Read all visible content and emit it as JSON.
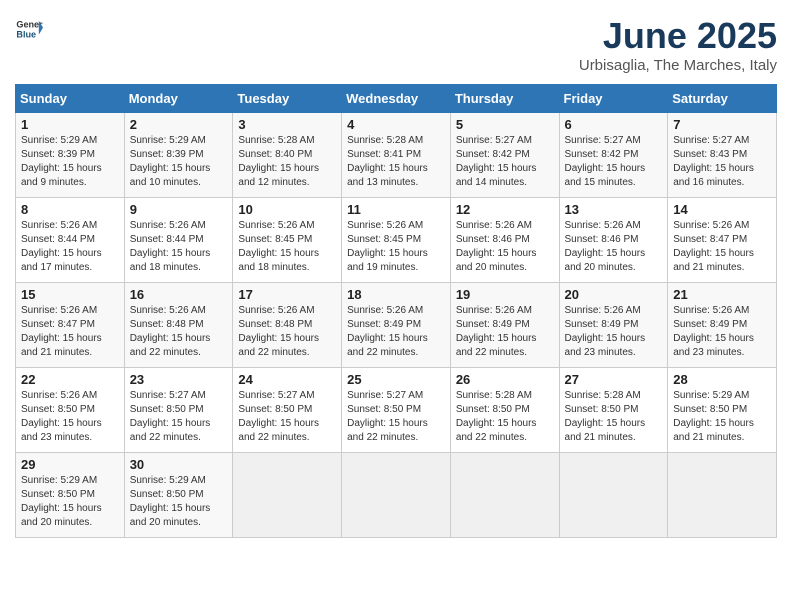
{
  "header": {
    "logo_general": "General",
    "logo_blue": "Blue",
    "title": "June 2025",
    "subtitle": "Urbisaglia, The Marches, Italy"
  },
  "calendar": {
    "days_of_week": [
      "Sunday",
      "Monday",
      "Tuesday",
      "Wednesday",
      "Thursday",
      "Friday",
      "Saturday"
    ],
    "weeks": [
      [
        {
          "day": "",
          "info": ""
        },
        {
          "day": "2",
          "info": "Sunrise: 5:29 AM\nSunset: 8:39 PM\nDaylight: 15 hours and 10 minutes."
        },
        {
          "day": "3",
          "info": "Sunrise: 5:28 AM\nSunset: 8:40 PM\nDaylight: 15 hours and 12 minutes."
        },
        {
          "day": "4",
          "info": "Sunrise: 5:28 AM\nSunset: 8:41 PM\nDaylight: 15 hours and 13 minutes."
        },
        {
          "day": "5",
          "info": "Sunrise: 5:27 AM\nSunset: 8:42 PM\nDaylight: 15 hours and 14 minutes."
        },
        {
          "day": "6",
          "info": "Sunrise: 5:27 AM\nSunset: 8:42 PM\nDaylight: 15 hours and 15 minutes."
        },
        {
          "day": "7",
          "info": "Sunrise: 5:27 AM\nSunset: 8:43 PM\nDaylight: 15 hours and 16 minutes."
        }
      ],
      [
        {
          "day": "1",
          "info": "Sunrise: 5:29 AM\nSunset: 8:39 PM\nDaylight: 15 hours and 9 minutes."
        },
        {
          "day": "",
          "info": ""
        },
        {
          "day": "",
          "info": ""
        },
        {
          "day": "",
          "info": ""
        },
        {
          "day": "",
          "info": ""
        },
        {
          "day": "",
          "info": ""
        },
        {
          "day": "",
          "info": ""
        }
      ],
      [
        {
          "day": "8",
          "info": "Sunrise: 5:26 AM\nSunset: 8:44 PM\nDaylight: 15 hours and 17 minutes."
        },
        {
          "day": "9",
          "info": "Sunrise: 5:26 AM\nSunset: 8:44 PM\nDaylight: 15 hours and 18 minutes."
        },
        {
          "day": "10",
          "info": "Sunrise: 5:26 AM\nSunset: 8:45 PM\nDaylight: 15 hours and 18 minutes."
        },
        {
          "day": "11",
          "info": "Sunrise: 5:26 AM\nSunset: 8:45 PM\nDaylight: 15 hours and 19 minutes."
        },
        {
          "day": "12",
          "info": "Sunrise: 5:26 AM\nSunset: 8:46 PM\nDaylight: 15 hours and 20 minutes."
        },
        {
          "day": "13",
          "info": "Sunrise: 5:26 AM\nSunset: 8:46 PM\nDaylight: 15 hours and 20 minutes."
        },
        {
          "day": "14",
          "info": "Sunrise: 5:26 AM\nSunset: 8:47 PM\nDaylight: 15 hours and 21 minutes."
        }
      ],
      [
        {
          "day": "15",
          "info": "Sunrise: 5:26 AM\nSunset: 8:47 PM\nDaylight: 15 hours and 21 minutes."
        },
        {
          "day": "16",
          "info": "Sunrise: 5:26 AM\nSunset: 8:48 PM\nDaylight: 15 hours and 22 minutes."
        },
        {
          "day": "17",
          "info": "Sunrise: 5:26 AM\nSunset: 8:48 PM\nDaylight: 15 hours and 22 minutes."
        },
        {
          "day": "18",
          "info": "Sunrise: 5:26 AM\nSunset: 8:49 PM\nDaylight: 15 hours and 22 minutes."
        },
        {
          "day": "19",
          "info": "Sunrise: 5:26 AM\nSunset: 8:49 PM\nDaylight: 15 hours and 22 minutes."
        },
        {
          "day": "20",
          "info": "Sunrise: 5:26 AM\nSunset: 8:49 PM\nDaylight: 15 hours and 23 minutes."
        },
        {
          "day": "21",
          "info": "Sunrise: 5:26 AM\nSunset: 8:49 PM\nDaylight: 15 hours and 23 minutes."
        }
      ],
      [
        {
          "day": "22",
          "info": "Sunrise: 5:26 AM\nSunset: 8:50 PM\nDaylight: 15 hours and 23 minutes."
        },
        {
          "day": "23",
          "info": "Sunrise: 5:27 AM\nSunset: 8:50 PM\nDaylight: 15 hours and 22 minutes."
        },
        {
          "day": "24",
          "info": "Sunrise: 5:27 AM\nSunset: 8:50 PM\nDaylight: 15 hours and 22 minutes."
        },
        {
          "day": "25",
          "info": "Sunrise: 5:27 AM\nSunset: 8:50 PM\nDaylight: 15 hours and 22 minutes."
        },
        {
          "day": "26",
          "info": "Sunrise: 5:28 AM\nSunset: 8:50 PM\nDaylight: 15 hours and 22 minutes."
        },
        {
          "day": "27",
          "info": "Sunrise: 5:28 AM\nSunset: 8:50 PM\nDaylight: 15 hours and 21 minutes."
        },
        {
          "day": "28",
          "info": "Sunrise: 5:29 AM\nSunset: 8:50 PM\nDaylight: 15 hours and 21 minutes."
        }
      ],
      [
        {
          "day": "29",
          "info": "Sunrise: 5:29 AM\nSunset: 8:50 PM\nDaylight: 15 hours and 20 minutes."
        },
        {
          "day": "30",
          "info": "Sunrise: 5:29 AM\nSunset: 8:50 PM\nDaylight: 15 hours and 20 minutes."
        },
        {
          "day": "",
          "info": ""
        },
        {
          "day": "",
          "info": ""
        },
        {
          "day": "",
          "info": ""
        },
        {
          "day": "",
          "info": ""
        },
        {
          "day": "",
          "info": ""
        }
      ]
    ]
  }
}
